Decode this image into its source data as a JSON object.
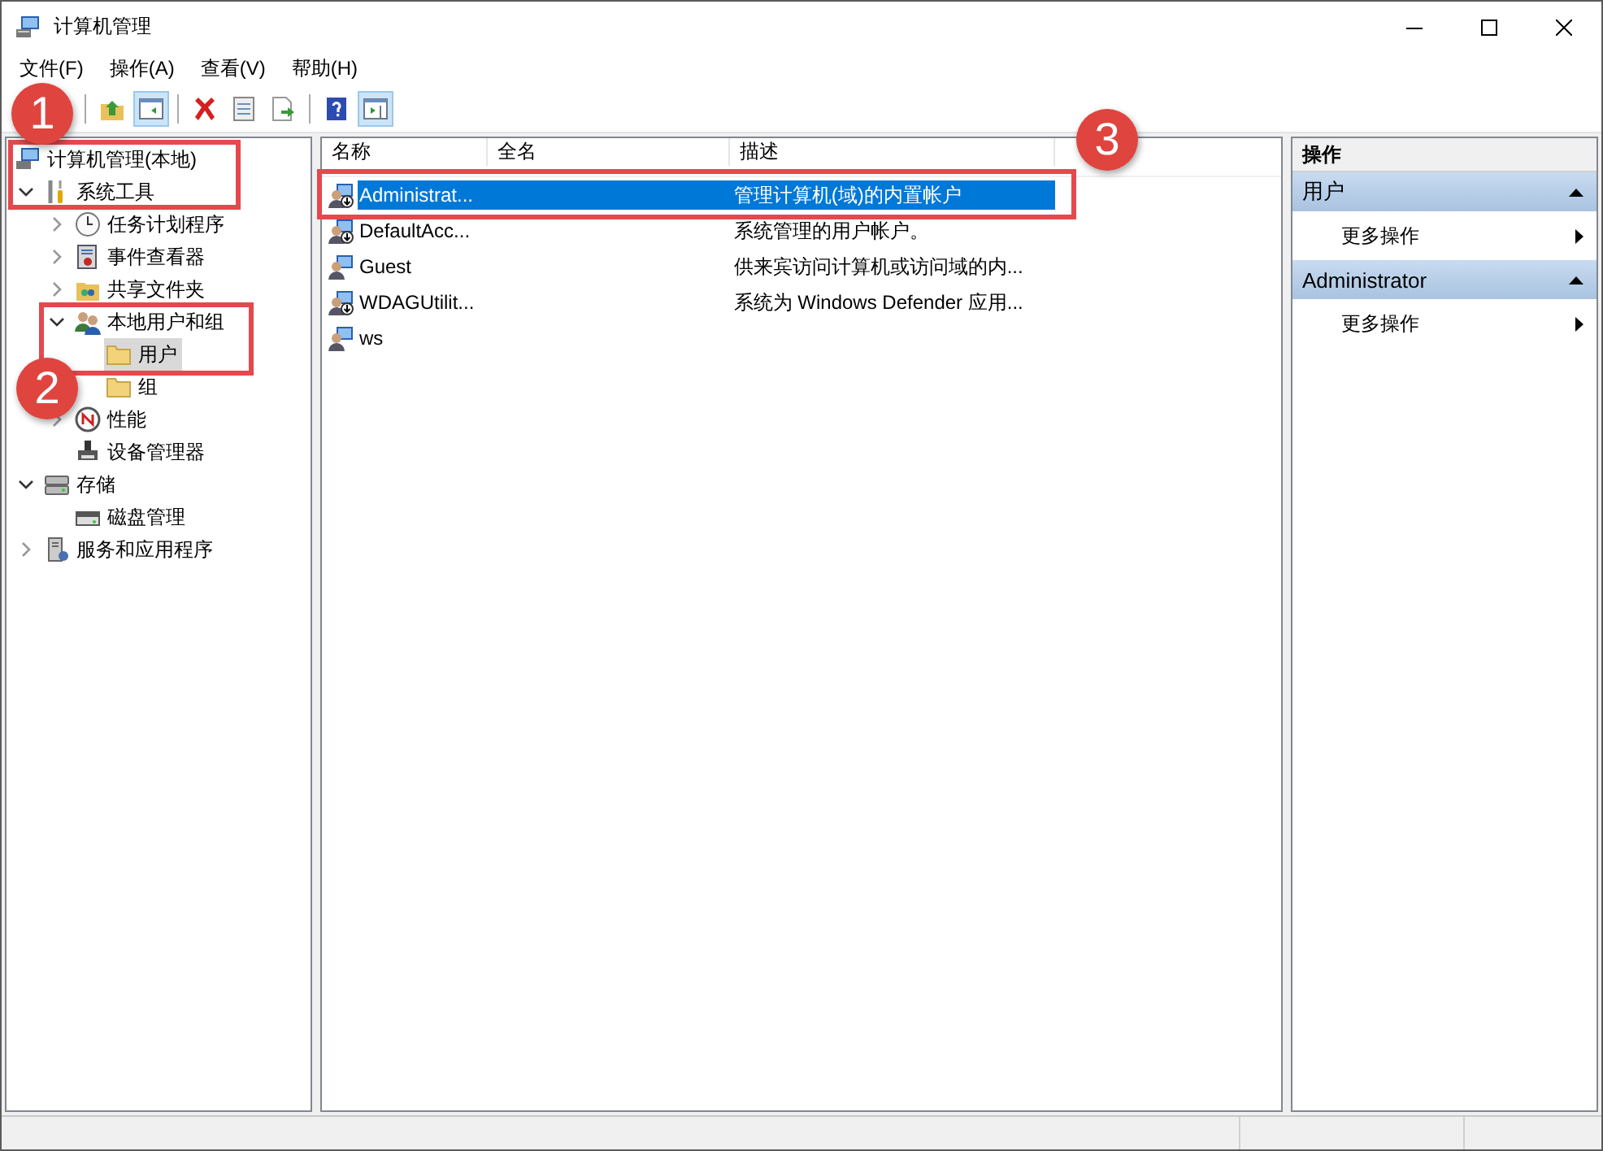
{
  "window": {
    "title": "计算机管理"
  },
  "menu": [
    "文件(F)",
    "操作(A)",
    "查看(V)",
    "帮助(H)"
  ],
  "toolbar": [
    {
      "kind": "up",
      "pressed": false
    },
    {
      "kind": "tree",
      "pressed": true
    },
    {
      "kind": "delete",
      "pressed": false
    },
    {
      "kind": "properties",
      "pressed": false
    },
    {
      "kind": "export",
      "pressed": false
    },
    {
      "kind": "help",
      "pressed": false
    },
    {
      "kind": "pane",
      "pressed": true
    }
  ],
  "tree": [
    {
      "label": "计算机管理(本地)",
      "kind": "computer",
      "selected": false,
      "children": [
        {
          "label": "系统工具",
          "kind": "tools",
          "selected": false,
          "expanded": true,
          "children": [
            {
              "label": "任务计划程序",
              "kind": "clock",
              "selected": false,
              "expanded": false
            },
            {
              "label": "事件查看器",
              "kind": "event",
              "selected": false,
              "expanded": false
            },
            {
              "label": "共享文件夹",
              "kind": "share",
              "selected": false,
              "expanded": false
            },
            {
              "label": "本地用户和组",
              "kind": "users",
              "selected": false,
              "expanded": true,
              "children": [
                {
                  "label": "用户",
                  "kind": "folder",
                  "selected": true
                },
                {
                  "label": "组",
                  "kind": "folder",
                  "selected": false
                }
              ]
            },
            {
              "label": "性能",
              "kind": "perf",
              "selected": false,
              "expanded": false
            },
            {
              "label": "设备管理器",
              "kind": "device",
              "selected": false
            }
          ]
        },
        {
          "label": "存储",
          "kind": "storage",
          "selected": false,
          "expanded": true,
          "children": [
            {
              "label": "磁盘管理",
              "kind": "disk",
              "selected": false
            }
          ]
        },
        {
          "label": "服务和应用程序",
          "kind": "services",
          "selected": false,
          "expanded": false
        }
      ]
    }
  ],
  "table": {
    "columns": [
      "名称",
      "全名",
      "描述"
    ],
    "rows": [
      {
        "name": "Administrat...",
        "description": "管理计算机(域)的内置帐户",
        "kind": "disabled",
        "selected": true
      },
      {
        "name": "DefaultAcc...",
        "description": "系统管理的用户帐户。",
        "kind": "disabled",
        "selected": false
      },
      {
        "name": "Guest",
        "description": "供来宾访问计算机或访问域的内...",
        "kind": "enabled",
        "selected": false
      },
      {
        "name": "WDAGUtilit...",
        "description": "系统为 Windows Defender 应用...",
        "kind": "disabled",
        "selected": false
      },
      {
        "name": "ws",
        "kind": "enabled",
        "selected": false
      }
    ]
  },
  "actions": {
    "title": "操作",
    "groups": [
      {
        "title": "用户",
        "items": [
          "更多操作"
        ]
      },
      {
        "title": "Administrator",
        "items": [
          "更多操作"
        ]
      }
    ]
  },
  "callouts": [
    "1",
    "2",
    "3"
  ]
}
